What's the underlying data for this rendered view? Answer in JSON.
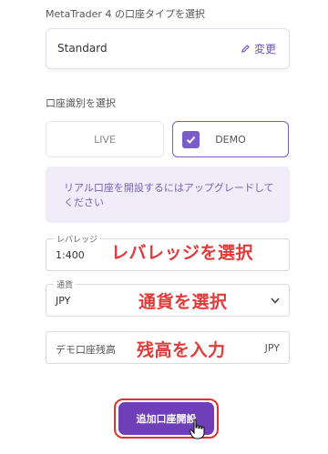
{
  "platform_section": {
    "label": "MetaTrader 4 の口座タイプを選択",
    "selected_type": "Standard",
    "change_label": "変更"
  },
  "account_section": {
    "label": "口座識別を選択",
    "options": [
      "LIVE",
      "DEMO"
    ],
    "selected": "DEMO"
  },
  "notice": {
    "text": "リアル口座を開設するにはアップグレードしてください"
  },
  "fields": {
    "leverage": {
      "legend": "レバレッジ",
      "value": "1:400"
    },
    "currency": {
      "legend": "通貨",
      "value": "JPY"
    },
    "balance": {
      "placeholder": "デモ口座残高",
      "suffix": "JPY"
    }
  },
  "annotations": {
    "leverage": "レバレッジを選択",
    "currency": "通貨を選択",
    "balance": "残高を入力"
  },
  "submit": {
    "label": "追加口座開設"
  },
  "colors": {
    "accent": "#7a5cc8",
    "button": "#6e3fb8",
    "annotation": "#e23a3a",
    "notice_bg": "#f1ecfa"
  }
}
